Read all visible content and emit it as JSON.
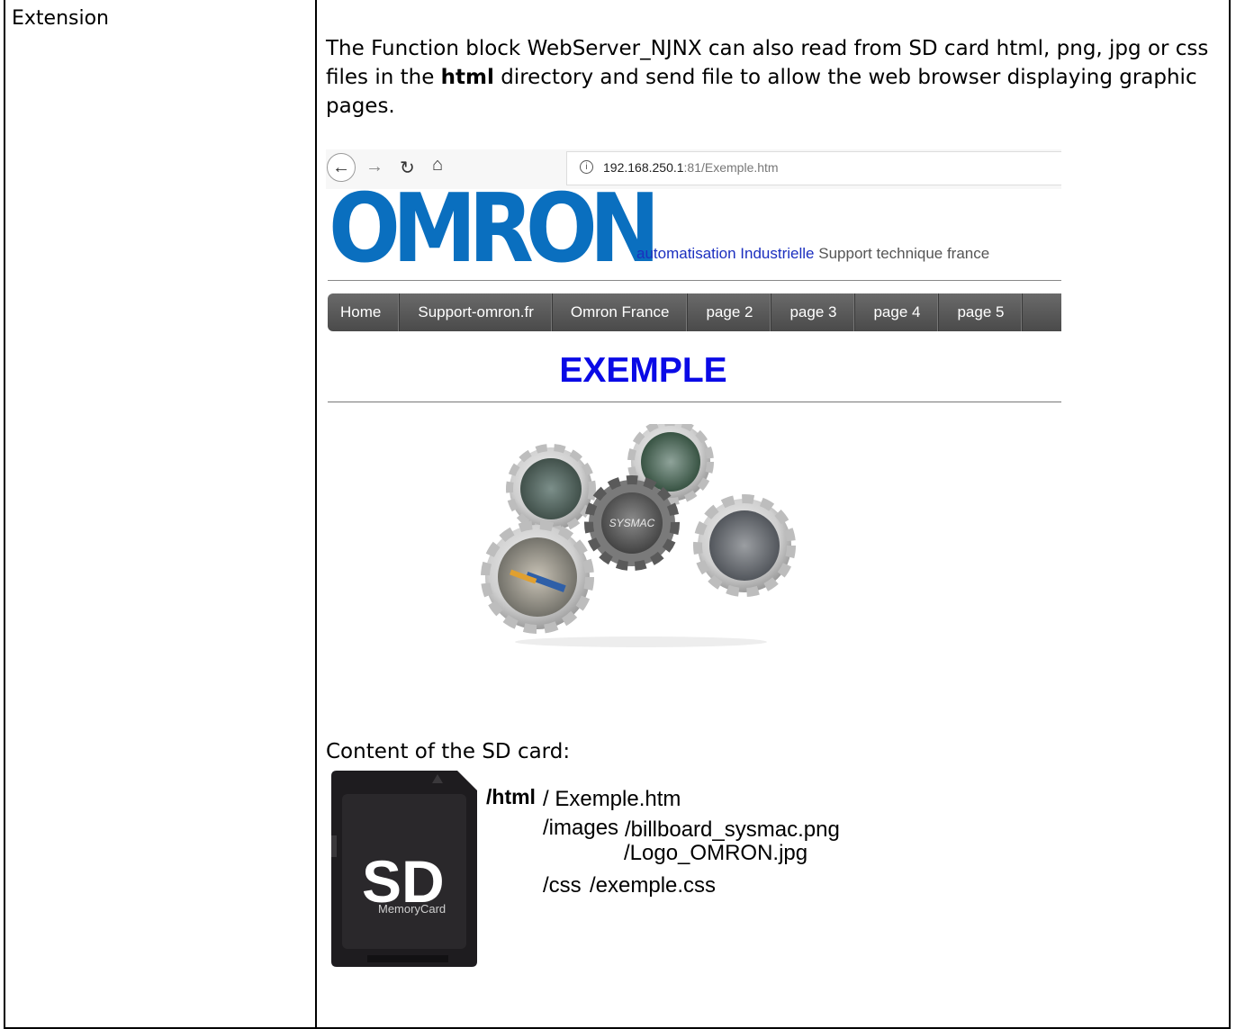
{
  "row": {
    "label": "Extension",
    "description_pre": "The Function block WebServer_NJNX can also read from SD card html, png, jpg or css files in the ",
    "description_bold": "html",
    "description_post": " directory and send file to allow the web browser displaying graphic pages."
  },
  "browser": {
    "nav_icons": [
      "back-arrow-icon",
      "forward-arrow-icon",
      "reload-icon",
      "home-icon"
    ],
    "url_host": "192.168.250.1",
    "url_path": ":81/Exemple.htm",
    "logo_text": "OMRON",
    "logo_color": "#0a6fbf",
    "tagline_main": "automatisation Industrielle",
    "tagline_sub": " Support technique france",
    "menu": [
      "Home",
      "Support-omron.fr",
      "Omron France",
      "page 2",
      "page 3",
      "page 4",
      "page 5"
    ],
    "heading": "EXEMPLE",
    "heading_color": "#0a0ae6",
    "gear_badge": "SYSMAC"
  },
  "sd": {
    "caption": "Content of the SD card:",
    "card_brand": "SD",
    "card_label": "MemoryCard",
    "tree": {
      "html_dir": "/html",
      "html_file": "/ Exemple.htm",
      "images_dir": "/images",
      "images_file_1": "/billboard_sysmac.png",
      "images_file_2": "/Logo_OMRON.jpg",
      "css_dir": "/css",
      "css_file": "/exemple.css"
    }
  }
}
